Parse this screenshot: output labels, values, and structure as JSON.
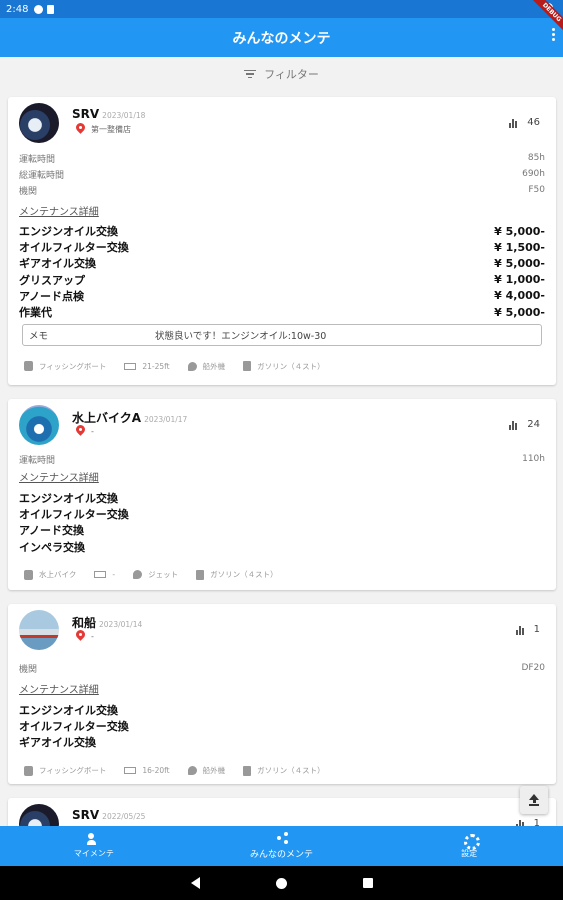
{
  "status": {
    "time": "2:48",
    "ribbon": "DEBUG"
  },
  "app": {
    "title": "みんなのメンテ"
  },
  "filter": {
    "label": "フィルター"
  },
  "cards": [
    {
      "name": "SRV",
      "date": "2023/01/18",
      "location": "第一整備店",
      "count": "46",
      "specs": [
        {
          "label": "運転時間",
          "value": "85h"
        },
        {
          "label": "総運転時間",
          "value": "690h"
        },
        {
          "label": "機関",
          "value": "F50"
        }
      ],
      "section": "メンテナンス詳細",
      "items": [
        {
          "name": "エンジンオイル交換",
          "price": "¥ 5,000-"
        },
        {
          "name": "オイルフィルター交換",
          "price": "¥ 1,500-"
        },
        {
          "name": "ギアオイル交換",
          "price": "¥ 5,000-"
        },
        {
          "name": "グリスアップ",
          "price": "¥ 1,000-"
        },
        {
          "name": "アノード点検",
          "price": "¥ 4,000-"
        },
        {
          "name": "作業代",
          "price": "¥ 5,000-"
        }
      ],
      "memo": {
        "label": "メモ",
        "text": "状態良いです！エンジンオイル:10w-30"
      },
      "tags": [
        "フィッシングボート",
        "21-25ft",
        "船外機",
        "ガソリン（４スト）"
      ]
    },
    {
      "name": "水上バイクA",
      "date": "2023/01/17",
      "location": "-",
      "count": "24",
      "specs": [
        {
          "label": "運転時間",
          "value": "110h"
        }
      ],
      "section": "メンテナンス詳細",
      "items": [
        {
          "name": "エンジンオイル交換",
          "price": ""
        },
        {
          "name": "オイルフィルター交換",
          "price": ""
        },
        {
          "name": "アノード交換",
          "price": ""
        },
        {
          "name": "インペラ交換",
          "price": ""
        }
      ],
      "tags": [
        "水上バイク",
        "-",
        "ジェット",
        "ガソリン（４スト）"
      ]
    },
    {
      "name": "和船",
      "date": "2023/01/14",
      "location": "-",
      "count": "1",
      "specs": [
        {
          "label": "機関",
          "value": "DF20"
        }
      ],
      "section": "メンテナンス詳細",
      "items": [
        {
          "name": "エンジンオイル交換",
          "price": ""
        },
        {
          "name": "オイルフィルター交換",
          "price": ""
        },
        {
          "name": "ギアオイル交換",
          "price": ""
        }
      ],
      "tags": [
        "フィッシングボート",
        "16-20ft",
        "船外機",
        "ガソリン（４スト）"
      ]
    },
    {
      "name": "SRV",
      "date": "2022/05/25",
      "count": "1"
    }
  ],
  "bottom_nav": [
    {
      "label": "マイメンテ",
      "icon": "people-icon"
    },
    {
      "label": "みんなのメンテ",
      "icon": "share-icon"
    },
    {
      "label": "設定",
      "icon": "gear-icon"
    }
  ]
}
